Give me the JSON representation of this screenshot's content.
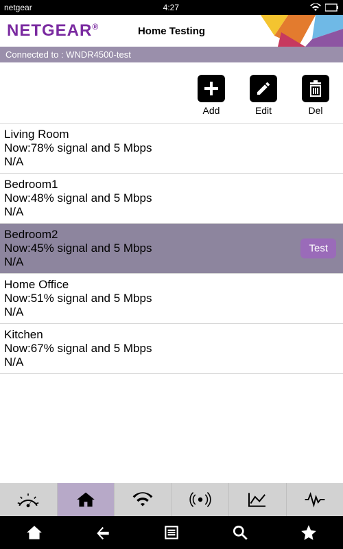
{
  "status": {
    "app_name": "netgear",
    "time": "4:27"
  },
  "header": {
    "logo": "NETGEAR",
    "title": "Home Testing"
  },
  "connected": {
    "prefix": "Connected to : ",
    "ssid": "WNDR4500-test"
  },
  "actions": {
    "add": "Add",
    "edit": "Edit",
    "del": "Del"
  },
  "rooms": [
    {
      "name": "Living Room",
      "detail": "Now:78% signal and 5 Mbps",
      "extra": "N/A",
      "selected": false
    },
    {
      "name": "Bedroom1",
      "detail": "Now:48% signal and 5 Mbps",
      "extra": "N/A",
      "selected": false
    },
    {
      "name": "Bedroom2",
      "detail": "Now:45% signal and 5 Mbps",
      "extra": "N/A",
      "selected": true,
      "button": "Test"
    },
    {
      "name": "Home Office",
      "detail": "Now:51% signal and 5 Mbps",
      "extra": "N/A",
      "selected": false
    },
    {
      "name": "Kitchen",
      "detail": "Now:67% signal and 5 Mbps",
      "extra": "N/A",
      "selected": false
    }
  ]
}
